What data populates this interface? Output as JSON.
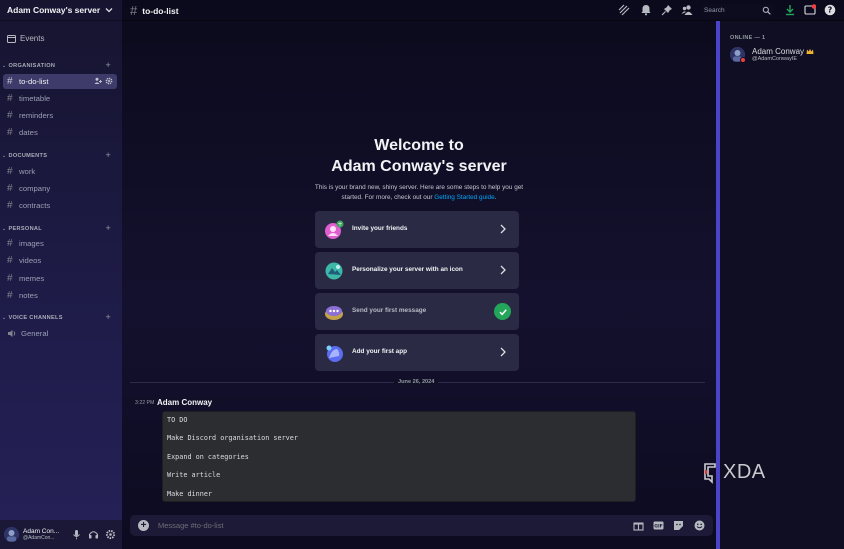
{
  "app": {
    "accent": "#4b44c8",
    "link_color": "#00a8fc"
  },
  "server": {
    "name": "Adam Conway's server"
  },
  "sidebar": {
    "events_label": "Events",
    "categories": [
      {
        "name": "ORGANISATION",
        "channels": [
          "to-do-list",
          "timetable",
          "reminders",
          "dates"
        ]
      },
      {
        "name": "DOCUMENTS",
        "channels": [
          "work",
          "company",
          "contracts"
        ]
      },
      {
        "name": "PERSONAL",
        "channels": [
          "images",
          "videos",
          "memes",
          "notes"
        ]
      },
      {
        "name": "VOICE CHANNELS",
        "channels": [
          "General"
        ]
      }
    ],
    "active_channel": "to-do-list"
  },
  "topbar": {
    "channel": "to-do-list",
    "search_placeholder": "Search"
  },
  "welcome": {
    "title_line1": "Welcome to",
    "title_line2": "Adam Conway's server",
    "desc_before": "This is your brand new, shiny server. Here are some steps to help you get started. For more, check out our ",
    "desc_link": "Getting Started guide",
    "desc_after": ".",
    "cards": [
      {
        "label": "Invite your friends",
        "done": false,
        "icon": "invite-friends-icon"
      },
      {
        "label": "Personalize your server with an icon",
        "done": false,
        "icon": "server-icon-icon"
      },
      {
        "label": "Send your first message",
        "done": true,
        "icon": "message-icon"
      },
      {
        "label": "Add your first app",
        "done": false,
        "icon": "app-icon"
      }
    ]
  },
  "messages": {
    "date_divider": "June 26, 2024",
    "time": "3:22 PM",
    "author": "Adam Conway",
    "code_lines": [
      "TO DO",
      "Make Discord organisation server",
      "Expand on categories",
      "Write article",
      "Make dinner"
    ]
  },
  "composer": {
    "placeholder": "Message #to-do-list"
  },
  "members": {
    "header": "ONLINE — 1",
    "list": [
      {
        "name": "Adam Conway",
        "handle": "@AdamConwayIE",
        "status": "dnd"
      }
    ]
  },
  "user_panel": {
    "name": "Adam Con...",
    "handle": "@AdamCon..."
  },
  "watermark": {
    "text": "XDA"
  }
}
